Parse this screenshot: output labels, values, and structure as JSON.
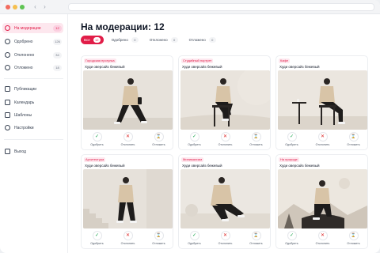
{
  "sidebar": {
    "items": [
      {
        "label": "На модерации",
        "badge": "12",
        "icon": "clock-icon",
        "active": true
      },
      {
        "label": "Одобрено",
        "badge": "126",
        "icon": "check-circle-icon",
        "active": false
      },
      {
        "label": "Отклонено",
        "badge": "34",
        "icon": "x-circle-icon",
        "active": false
      },
      {
        "label": "Отложено",
        "badge": "18",
        "icon": "hourglass-icon",
        "active": false
      }
    ],
    "nav": [
      {
        "label": "Публикации",
        "icon": "document-icon"
      },
      {
        "label": "Календарь",
        "icon": "calendar-icon"
      },
      {
        "label": "Шаблоны",
        "icon": "template-icon"
      },
      {
        "label": "Настройки",
        "icon": "gear-icon"
      }
    ],
    "logout": {
      "label": "Выход",
      "icon": "logout-icon"
    }
  },
  "main": {
    "title": "На модерации: 12",
    "tabs": [
      {
        "label": "Все",
        "count": "12",
        "active": true
      },
      {
        "label": "Одобрено",
        "count": "0",
        "active": false
      },
      {
        "label": "Отклонено",
        "count": "0",
        "active": false
      },
      {
        "label": "Отложено",
        "count": "0",
        "active": false
      }
    ],
    "actions": {
      "approve": "Одобрить",
      "reject": "Отклонить",
      "defer": "Отложить"
    },
    "cards": [
      {
        "tag": "Городская прогулка",
        "title": "Худи оверсайз бежевый"
      },
      {
        "tag": "Студийный портрет",
        "title": "Худи оверсайз бежевый"
      },
      {
        "tag": "Кафе",
        "title": "Худи оверсайз бежевый"
      },
      {
        "tag": "Архитектура",
        "title": "Худи оверсайз бежевый"
      },
      {
        "tag": "Минимализм",
        "title": "Худи оверсайз бежевый"
      },
      {
        "tag": "На природе",
        "title": "Худи оверсайз бежевый"
      }
    ]
  },
  "colors": {
    "accent": "#e11d48",
    "approve": "#16a34a",
    "reject": "#dc2626"
  }
}
